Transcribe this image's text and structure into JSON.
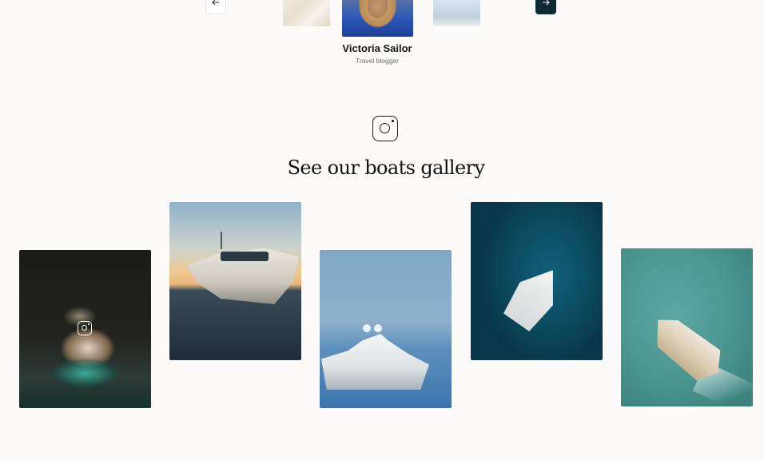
{
  "testimonial": {
    "name": "Victoria Sailor",
    "role": "Travel blogger",
    "prev_icon": "arrow-left-icon",
    "next_icon": "arrow-right-icon"
  },
  "gallery": {
    "header_icon": "instagram-icon",
    "title": "See our boats gallery",
    "items": [
      {
        "subject": "yacht-at-night-photo",
        "hover_icon": "instagram-icon"
      },
      {
        "subject": "yacht-at-sunset-photo"
      },
      {
        "subject": "superyacht-at-sea-photo"
      },
      {
        "subject": "sailboat-aerial-photo"
      },
      {
        "subject": "motor-yacht-aerial-photo"
      }
    ]
  },
  "colors": {
    "background": "#fcfbfa",
    "accent_dark": "#0f2a33",
    "text": "#1b1b1b"
  }
}
